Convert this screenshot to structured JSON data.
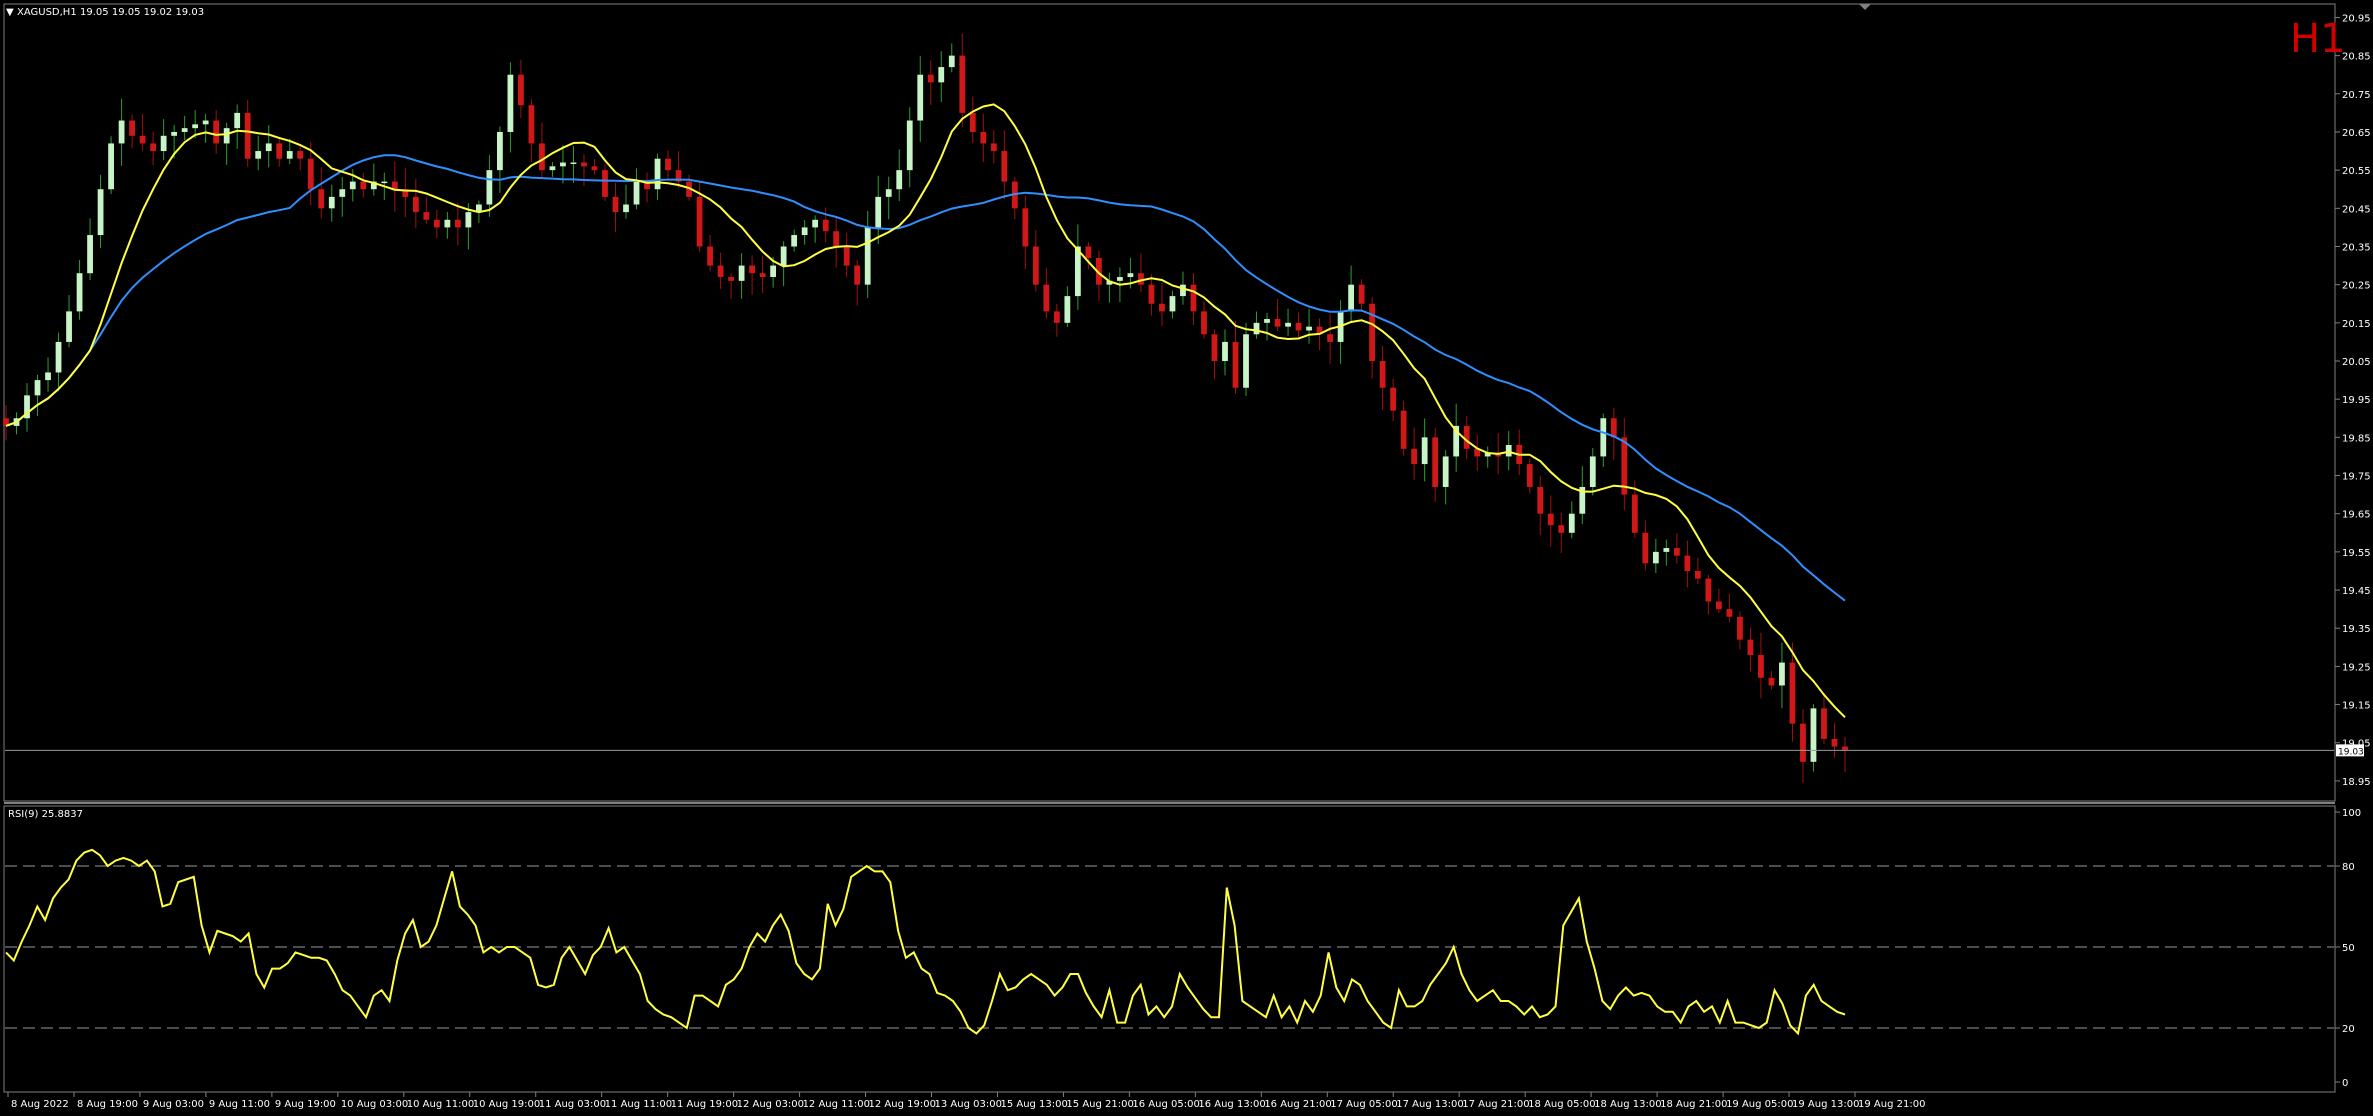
{
  "colors": {
    "background": "#000000",
    "frame": "#808080",
    "bull_candle": "#c8f5c8",
    "bear_candle": "#d01818",
    "fast_ma": "#ffff40",
    "slow_ma": "#2f8fff",
    "rsi_line": "#ffff40",
    "timeframe_label": "#d00000",
    "text": "#ffffff"
  },
  "chart_data": [
    {
      "type": "candlestick",
      "symbol_header": "XAGUSD,H1",
      "ohlc_header": "19.05 19.02 19.03",
      "header_high": "19.05",
      "timeframe_label": "H1",
      "ylim": [
        18.9,
        20.98
      ],
      "yticks": [
        "20.95",
        "20.85",
        "20.75",
        "20.65",
        "20.55",
        "20.45",
        "20.35",
        "20.25",
        "20.15",
        "20.05",
        "19.95",
        "19.85",
        "19.75",
        "19.65",
        "19.55",
        "19.45",
        "19.35",
        "19.25",
        "19.15",
        "19.05",
        "18.95"
      ],
      "current_price": "19.03",
      "x_labels": [
        "8 Aug 2022",
        "8 Aug 19:00",
        "9 Aug 03:00",
        "9 Aug 11:00",
        "9 Aug 19:00",
        "10 Aug 03:00",
        "10 Aug 11:00",
        "10 Aug 19:00",
        "11 Aug 03:00",
        "11 Aug 11:00",
        "11 Aug 19:00",
        "12 Aug 03:00",
        "12 Aug 11:00",
        "12 Aug 19:00",
        "13 Aug 03:00",
        "15 Aug 13:00",
        "15 Aug 21:00",
        "16 Aug 05:00",
        "16 Aug 13:00",
        "16 Aug 21:00",
        "17 Aug 05:00",
        "17 Aug 13:00",
        "17 Aug 21:00",
        "18 Aug 05:00",
        "18 Aug 13:00",
        "18 Aug 21:00",
        "19 Aug 05:00",
        "19 Aug 13:00",
        "19 Aug 21:00"
      ],
      "close": [
        19.88,
        19.9,
        19.96,
        20.0,
        20.02,
        20.1,
        20.18,
        20.28,
        20.38,
        20.5,
        20.62,
        20.68,
        20.64,
        20.62,
        20.6,
        20.64,
        20.65,
        20.66,
        20.67,
        20.68,
        20.62,
        20.66,
        20.7,
        20.58,
        20.6,
        20.62,
        20.58,
        20.6,
        20.58,
        20.5,
        20.45,
        20.48,
        20.5,
        20.52,
        20.5,
        20.52,
        20.52,
        20.5,
        20.48,
        20.44,
        20.42,
        20.4,
        20.42,
        20.4,
        20.44,
        20.46,
        20.55,
        20.65,
        20.8,
        20.72,
        20.62,
        20.55,
        20.56,
        20.57,
        20.57,
        20.56,
        20.55,
        20.48,
        20.44,
        20.46,
        20.52,
        20.5,
        20.58,
        20.55,
        20.52,
        20.48,
        20.35,
        20.3,
        20.27,
        20.26,
        20.3,
        20.28,
        20.27,
        20.3,
        20.35,
        20.38,
        20.4,
        20.42,
        20.39,
        20.35,
        20.3,
        20.25,
        20.4,
        20.48,
        20.5,
        20.55,
        20.68,
        20.8,
        20.78,
        20.82,
        20.85,
        20.7,
        20.65,
        20.62,
        20.6,
        20.52,
        20.45,
        20.35,
        20.25,
        20.18,
        20.15,
        20.22,
        20.35,
        20.32,
        20.25,
        20.26,
        20.27,
        20.28,
        20.25,
        20.2,
        20.18,
        20.22,
        20.25,
        20.18,
        20.12,
        20.05,
        20.1,
        19.98,
        20.12,
        20.15,
        20.16,
        20.14,
        20.15,
        20.13,
        20.14,
        20.12,
        20.1,
        20.18,
        20.25,
        20.2,
        20.05,
        19.98,
        19.92,
        19.82,
        19.78,
        19.85,
        19.72,
        19.8,
        19.88,
        19.82,
        19.8,
        19.81,
        19.8,
        19.83,
        19.78,
        19.72,
        19.65,
        19.62,
        19.6,
        19.65,
        19.72,
        19.8,
        19.9,
        19.85,
        19.7,
        19.6,
        19.52,
        19.55,
        19.56,
        19.54,
        19.5,
        19.48,
        19.42,
        19.4,
        19.38,
        19.32,
        19.28,
        19.22,
        19.2,
        19.26,
        19.1,
        19.0,
        19.14,
        19.06,
        19.04,
        19.03
      ],
      "fast_ma_label": "",
      "slow_ma_label": ""
    },
    {
      "type": "line",
      "header": "RSI(9) 25.8837",
      "ylim": [
        0,
        100
      ],
      "yticks": [
        "100",
        "80",
        "50",
        "20",
        "0"
      ],
      "levels": [
        80,
        50,
        20
      ],
      "values": [
        48,
        45,
        52,
        58,
        65,
        60,
        68,
        72,
        75,
        82,
        85,
        86,
        84,
        80,
        82,
        83,
        82,
        80,
        82,
        78,
        65,
        66,
        74,
        75,
        76,
        58,
        48,
        56,
        55,
        54,
        52,
        55,
        40,
        35,
        42,
        42,
        44,
        48,
        47,
        46,
        46,
        45,
        40,
        34,
        32,
        28,
        24,
        32,
        34,
        30,
        45,
        55,
        60,
        50,
        52,
        58,
        68,
        78,
        65,
        62,
        58,
        48,
        50,
        48,
        50,
        50,
        48,
        46,
        36,
        35,
        36,
        46,
        50,
        45,
        40,
        47,
        50,
        57,
        48,
        50,
        45,
        40,
        30,
        27,
        25,
        24,
        22,
        20,
        32,
        32,
        30,
        28,
        36,
        38,
        42,
        50,
        55,
        52,
        58,
        62,
        56,
        44,
        40,
        38,
        42,
        66,
        58,
        64,
        76,
        78,
        80,
        78,
        78,
        74,
        56,
        46,
        48,
        42,
        40,
        33,
        32,
        30,
        26,
        20,
        18,
        21,
        30,
        40,
        34,
        35,
        38,
        40,
        38,
        36,
        32,
        35,
        40,
        40,
        33,
        28,
        24,
        34,
        22,
        22,
        32,
        36,
        25,
        28,
        24,
        28,
        40,
        35,
        31,
        27,
        24,
        24,
        72,
        58,
        30,
        28,
        26,
        24,
        32,
        24,
        28,
        22,
        30,
        26,
        32,
        48,
        35,
        30,
        38,
        36,
        30,
        26,
        22,
        20,
        34,
        28,
        28,
        30,
        36,
        40,
        44,
        50,
        40,
        34,
        30,
        32,
        34,
        30,
        30,
        28,
        25,
        28,
        24,
        25,
        28,
        58,
        63,
        68,
        52,
        42,
        30,
        27,
        32,
        35,
        32,
        33,
        32,
        28,
        26,
        26,
        22,
        28,
        30,
        26,
        28,
        22,
        30,
        22,
        22,
        21,
        20,
        22,
        34,
        29,
        21,
        18,
        32,
        36,
        30,
        28,
        26,
        25
      ]
    }
  ]
}
